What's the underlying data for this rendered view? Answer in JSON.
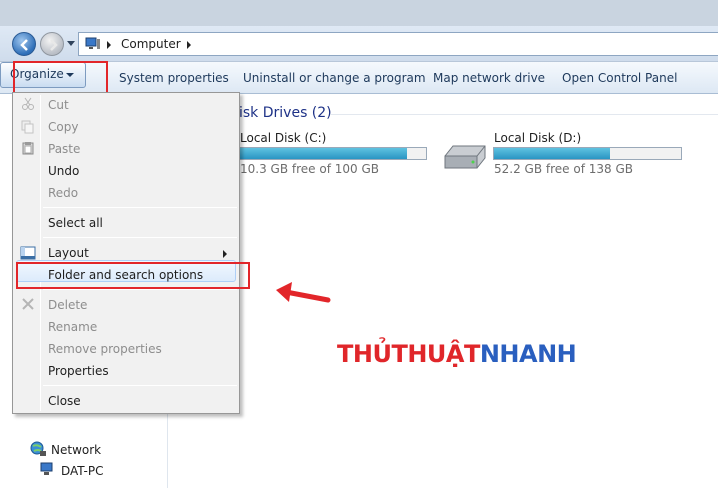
{
  "address": {
    "crumb": "Computer"
  },
  "toolbar": {
    "organize": "Organize",
    "system_properties": "System properties",
    "uninstall": "Uninstall or change a program",
    "map_drive": "Map network drive",
    "control_panel": "Open Control Panel"
  },
  "menu": {
    "cut": "Cut",
    "copy": "Copy",
    "paste": "Paste",
    "undo": "Undo",
    "redo": "Redo",
    "select_all": "Select all",
    "layout": "Layout",
    "folder_options": "Folder and search options",
    "delete": "Delete",
    "rename": "Rename",
    "remove_properties": "Remove properties",
    "properties": "Properties",
    "close": "Close"
  },
  "content": {
    "section_title": "isk Drives (2)",
    "drives": [
      {
        "name": "Local Disk (C:)",
        "free": "10.3 GB free of 100 GB",
        "used_fraction": 0.897
      },
      {
        "name": "Local Disk (D:)",
        "free": "52.2 GB free of 138 GB",
        "used_fraction": 0.622
      }
    ]
  },
  "navpane": {
    "network": "Network",
    "pc": "DAT-PC"
  },
  "watermark": {
    "part1": "THỦTHUẬT",
    "part2": "NHANH"
  },
  "colors": {
    "highlight_red": "#e2262a",
    "accent_blue": "#1e3287",
    "bar_fill": "#2a95c3"
  }
}
